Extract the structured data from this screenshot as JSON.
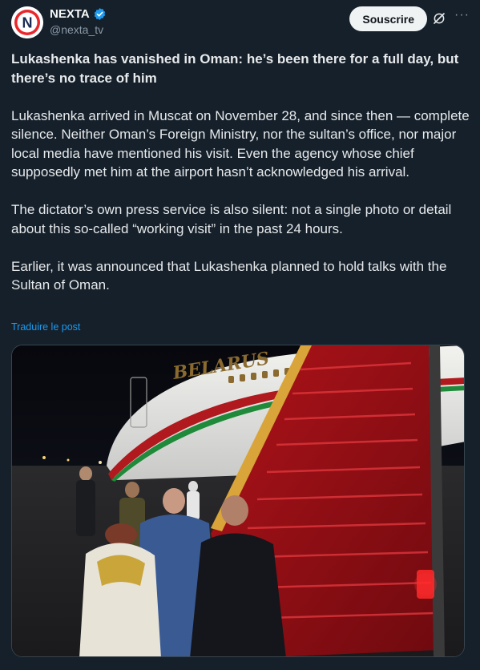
{
  "account": {
    "display_name": "NEXTA",
    "handle": "@nexta_tv",
    "verified_icon": "verified-badge-icon",
    "avatar_icon": "nexta-logo-icon",
    "avatar_letter": "N"
  },
  "actions": {
    "follow_label": "Souscrire",
    "grok_icon": "grok-icon",
    "more_icon": "more-options-icon"
  },
  "tweet": {
    "headline": "Lukashenka has vanished in Oman: he’s been there for a full day, but there’s no trace of him",
    "paragraphs": [
      "Lukashenka arrived in Muscat on November 28, and since then — complete silence. Neither Oman’s Foreign Ministry, nor the sultan’s office, nor major local media have mentioned his visit. Even the agency whose chief supposedly met him at the airport hasn’t acknowledged his arrival.",
      "The dictator’s own press service is also silent: not a single photo or detail about this so-called “working visit” in the past 24 hours.",
      "Earlier, it was announced that Lukashenka planned to hold talks with the Sultan of Oman."
    ],
    "translate_label": "Traduire le post"
  },
  "photo": {
    "aircraft_lettering": "BELARUS"
  },
  "colors": {
    "background": "#15202b",
    "accent": "#1d9bf0",
    "muted": "#8b98a5",
    "button_bg": "#eff3f4",
    "stair_red": "#c0161e"
  }
}
